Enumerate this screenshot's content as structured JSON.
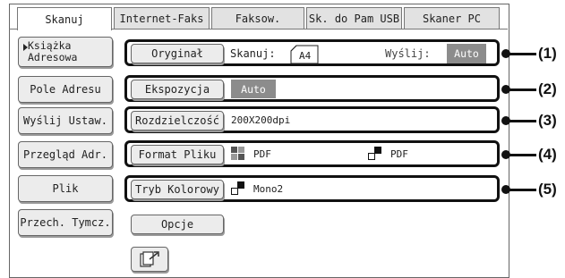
{
  "tabs": [
    "Skanuj",
    "Internet-Faks",
    "Faksow.",
    "Sk. do Pam USB",
    "Skaner PC"
  ],
  "left_buttons": {
    "address_book_line1": "Książka",
    "address_book_line2": "Adresowa",
    "address_entry": "Pole Adresu",
    "send_settings": "Wyślij Ustaw.",
    "address_review": "Przegląd Adr.",
    "file": "Plik",
    "quick_file": "Przech. Tymcz."
  },
  "rows": {
    "original": {
      "button": "Oryginał",
      "scan_label": "Skanuj:",
      "paper": "A4",
      "send_label": "Wyślij:",
      "send_value": "Auto"
    },
    "exposure": {
      "button": "Ekspozycja",
      "value": "Auto"
    },
    "resolution": {
      "button": "Rozdzielczość",
      "value": "200X200dpi"
    },
    "file_format": {
      "button": "Format Pliku",
      "color_format": "PDF",
      "mono_format": "PDF"
    },
    "color_mode": {
      "button": "Tryb Kolorowy",
      "value": "Mono2"
    },
    "options": {
      "button": "Opcje"
    }
  },
  "callouts": [
    "(1)",
    "(2)",
    "(3)",
    "(4)",
    "(5)"
  ],
  "icons": {
    "bottom": "send-arrow-icon",
    "book_arrow": "triangle-right-icon",
    "paper": "paper-page-icon",
    "color_grid": "color-grid-icon",
    "mono": "mono-squares-icon"
  },
  "colors": {
    "chip": "#8c8c8c",
    "callout": "#111111"
  }
}
